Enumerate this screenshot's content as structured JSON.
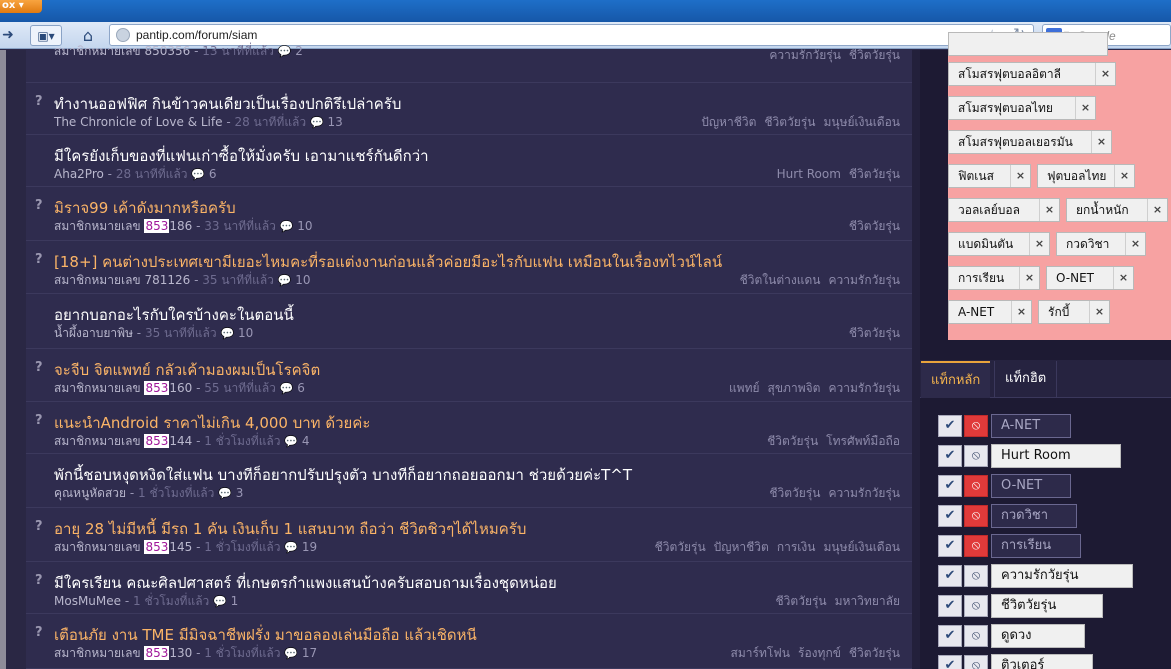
{
  "browser": {
    "app_menu": "ox",
    "url": "pantip.com/forum/siam",
    "search_placeholder": "Google",
    "search_engine_letter": "g"
  },
  "topics": [
    {
      "q": "",
      "title": "",
      "author": "สมาชิกหมายเลข 850356",
      "author_hl": "",
      "author_rest": "",
      "time": "13 นาทีที่แล้ว",
      "comments": "2",
      "tags": [
        "ความรักวัยรุ่น",
        "ชีวิตวัยรุ่น"
      ],
      "orange": false
    },
    {
      "q": "?",
      "title": "ทำงานออฟฟิศ กินข้าวคนเดียวเป็นเรื่องปกติรึเปล่าครับ",
      "author": "The Chronicle of Love & Life",
      "author_hl": "",
      "author_rest": "",
      "time": "28 นาทีที่แล้ว",
      "comments": "13",
      "tags": [
        "ปัญหาชีวิต",
        "ชีวิตวัยรุ่น",
        "มนุษย์เงินเดือน"
      ],
      "orange": false
    },
    {
      "q": "",
      "title": "มีใครยังเก็บของที่แฟนเก่าซื้อให้มั่งครับ เอามาแชร์กันดีกว่า",
      "author": "Aha2Pro",
      "author_hl": "",
      "author_rest": "",
      "time": "28 นาทีที่แล้ว",
      "comments": "6",
      "tags": [
        "Hurt Room",
        "ชีวิตวัยรุ่น"
      ],
      "orange": false
    },
    {
      "q": "?",
      "title": "มิราจ99 เค้าดังมากหรือครับ",
      "author": "สมาชิกหมายเลข ",
      "author_hl": "853",
      "author_rest": "186",
      "time": "33 นาทีที่แล้ว",
      "comments": "10",
      "tags": [
        "ชีวิตวัยรุ่น"
      ],
      "orange": true
    },
    {
      "q": "?",
      "title": "[18+] คนต่างประเทศเขามีเยอะไหมคะที่รอแต่งงานก่อนแล้วค่อยมีอะไรกับแฟน เหมือนในเรื่องทไวน์ไลน์",
      "author": "สมาชิกหมายเลข 781126",
      "author_hl": "",
      "author_rest": "",
      "time": "35 นาทีที่แล้ว",
      "comments": "10",
      "tags": [
        "ชีวิตในต่างแดน",
        "ความรักวัยรุ่น"
      ],
      "orange": true
    },
    {
      "q": "",
      "title": "อยากบอกอะไรกับใครบ้างคะในตอนนี้",
      "author": "น้ำผึ้งอาบยาพิษ",
      "author_hl": "",
      "author_rest": "",
      "time": "35 นาทีที่แล้ว",
      "comments": "10",
      "tags": [
        "ชีวิตวัยรุ่น"
      ],
      "orange": false
    },
    {
      "q": "?",
      "title": "จะจีบ จิตแพทย์ กลัวเค้ามองผมเป็นโรคจิต",
      "author": "สมาชิกหมายเลข ",
      "author_hl": "853",
      "author_rest": "160",
      "time": "55 นาทีที่แล้ว",
      "comments": "6",
      "tags": [
        "แพทย์",
        "สุขภาพจิต",
        "ความรักวัยรุ่น"
      ],
      "orange": true
    },
    {
      "q": "?",
      "title": "แนะนำAndroid ราคาไม่เกิน 4,000 บาท ด้วยค่ะ",
      "author": "สมาชิกหมายเลข ",
      "author_hl": "853",
      "author_rest": "144",
      "time": "1 ชั่วโมงที่แล้ว",
      "comments": "4",
      "tags": [
        "ชีวิตวัยรุ่น",
        "โทรศัพท์มือถือ"
      ],
      "orange": true
    },
    {
      "q": "",
      "title": "พักนี้ชอบหงุดหงิดใส่แฟน บางทีก็อยากปรับปรุงตัว บางทีก็อยากถอยออกมา ช่วยด้วยค่ะT^T",
      "author": "คุณหนูหัดสวย",
      "author_hl": "",
      "author_rest": "",
      "time": "1 ชั่วโมงที่แล้ว",
      "comments": "3",
      "tags": [
        "ชีวิตวัยรุ่น",
        "ความรักวัยรุ่น"
      ],
      "orange": false
    },
    {
      "q": "?",
      "title": "อายุ 28 ไม่มีหนี้ มีรถ 1 คัน เงินเก็บ 1 แสนบาท ถือว่า ชีวิตชิวๆได้ไหมครับ",
      "author": "สมาชิกหมายเลข ",
      "author_hl": "853",
      "author_rest": "145",
      "time": "1 ชั่วโมงที่แล้ว",
      "comments": "19",
      "tags": [
        "ชีวิตวัยรุ่น",
        "ปัญหาชีวิต",
        "การเงิน",
        "มนุษย์เงินเดือน"
      ],
      "orange": true
    },
    {
      "q": "?",
      "title": "มีใครเรียน คณะศิลปศาสตร์ ที่เกษตรกำแพงแสนบ้างครับสอบถามเรื่องชุดหน่อย",
      "author": "MosMuMee",
      "author_hl": "",
      "author_rest": "",
      "time": "1 ชั่วโมงที่แล้ว",
      "comments": "1",
      "tags": [
        "ชีวิตวัยรุ่น",
        "มหาวิทยาลัย"
      ],
      "orange": false
    },
    {
      "q": "?",
      "title": "เตือนภัย งาน TME มีมิจฉาชีพฝรั่ง มาขอลองเล่นมือถือ แล้วเชิดหนี",
      "author": "สมาชิกหมายเลข ",
      "author_hl": "853",
      "author_rest": "130",
      "time": "1 ชั่วโมงที่แล้ว",
      "comments": "17",
      "tags": [
        "สมาร์ทโฟน",
        "ร้องทุกข์",
        "ชีวิตวัยรุ่น"
      ],
      "orange": true
    }
  ],
  "followed_tags": [
    {
      "label": "สโมสรฟุตบอลอิตาลี"
    },
    {
      "label": "สโมสรฟุตบอลไทย"
    },
    {
      "label": "สโมสรฟุตบอลเยอรมัน"
    },
    {
      "label": "ฟิตเนส"
    },
    {
      "label": "ฟุตบอลไทย"
    },
    {
      "label": "วอลเลย์บอล"
    },
    {
      "label": "ยกน้ำหนัก"
    },
    {
      "label": "แบดมินตัน"
    },
    {
      "label": "กวดวิชา"
    },
    {
      "label": "การเรียน"
    },
    {
      "label": "O-NET"
    },
    {
      "label": "A-NET"
    },
    {
      "label": "รักบี้"
    }
  ],
  "chip_remove_glyph": "×",
  "tabs": {
    "main": "แท็กหลัก",
    "hot": "แท็กฮิต"
  },
  "tag_rows": [
    {
      "label": "A-NET",
      "blocked": true
    },
    {
      "label": "Hurt Room",
      "blocked": false
    },
    {
      "label": "O-NET",
      "blocked": true
    },
    {
      "label": "กวดวิชา",
      "blocked": true
    },
    {
      "label": "การเรียน",
      "blocked": true
    },
    {
      "label": "ความรักวัยรุ่น",
      "blocked": false
    },
    {
      "label": "ชีวิตวัยรุ่น",
      "blocked": false
    },
    {
      "label": "ดูดวง",
      "blocked": false
    },
    {
      "label": "ติวเตอร์",
      "blocked": false
    }
  ],
  "icons": {
    "check": "check-icon",
    "block": "block-icon",
    "comment": "comment-icon",
    "question": "question-icon"
  },
  "colors": {
    "orange_title": "#fbb467",
    "highlight_text": "#a0179a",
    "blocked_red": "#e03a3a",
    "followed_bg": "#f7a2a2",
    "active_tab": "#f5b44d"
  }
}
